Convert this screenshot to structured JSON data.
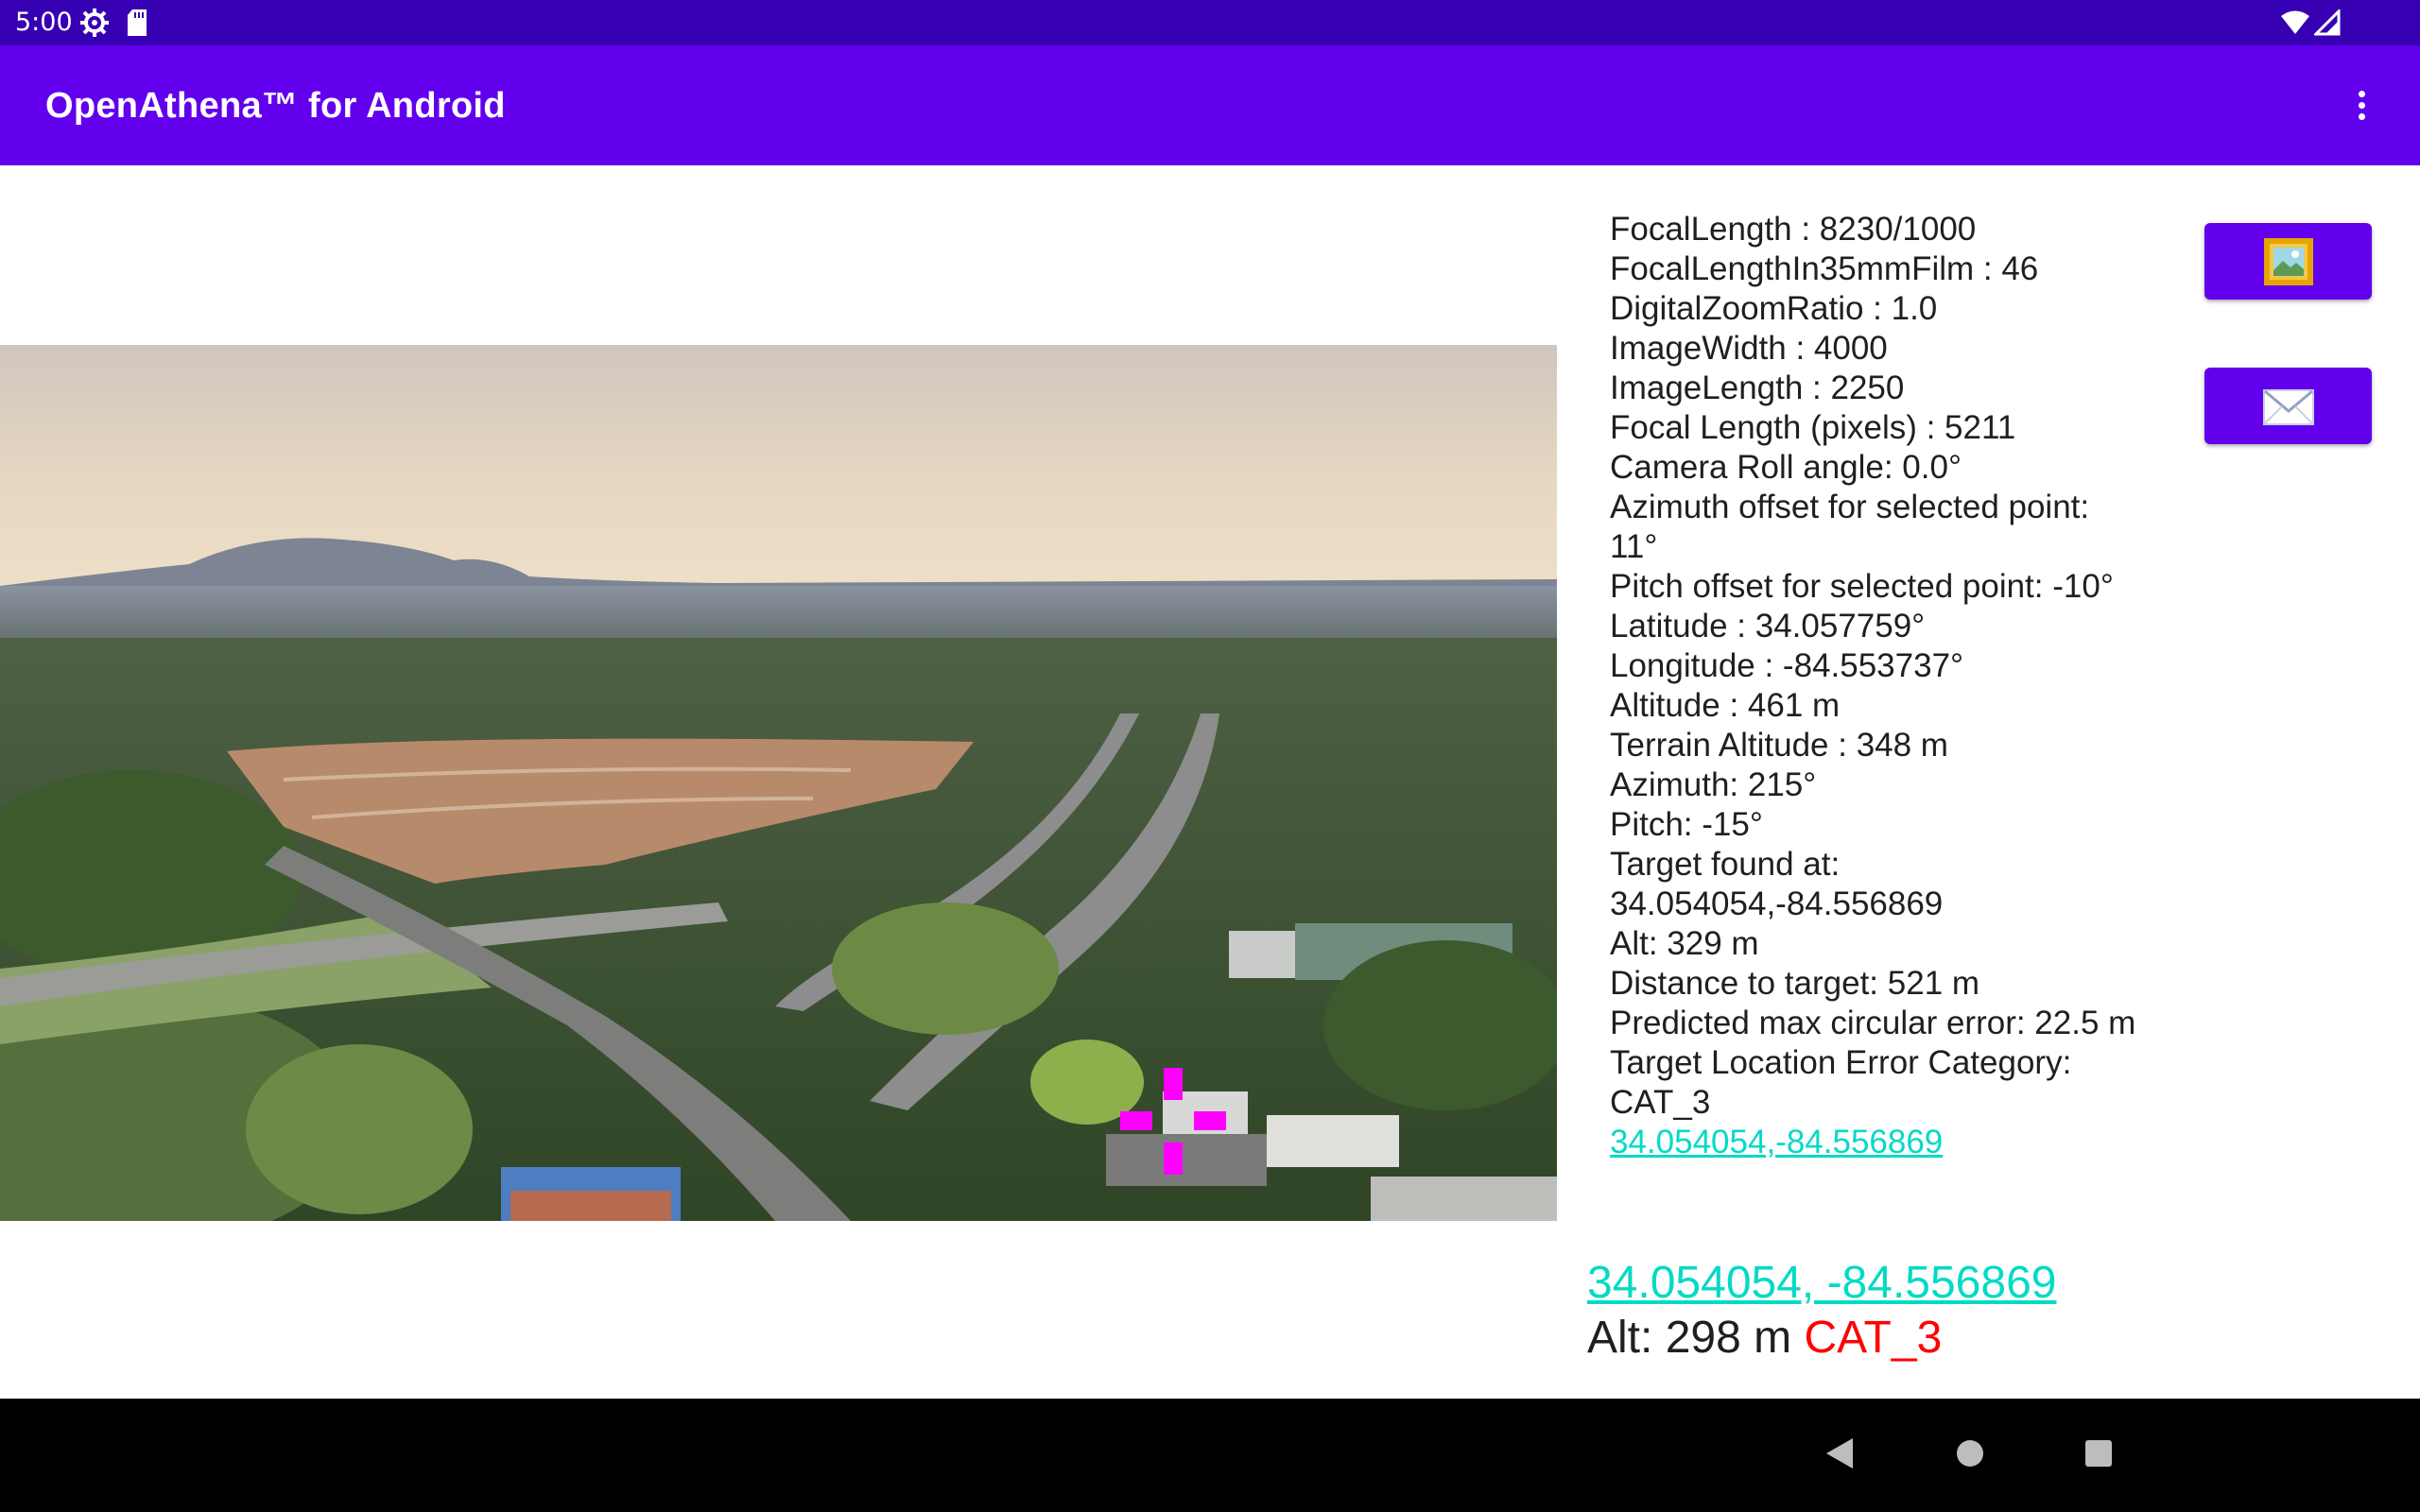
{
  "status_bar": {
    "time": "5:00",
    "icons": [
      "gear-icon",
      "sd-card-icon",
      "wifi-icon",
      "signal-icon"
    ]
  },
  "app_bar": {
    "title": "OpenAthena™ for Android",
    "menu_icon": "more-vert-icon"
  },
  "photo": {
    "description_icon": "aerial-photo",
    "marker_color": "#ff00ff"
  },
  "info": {
    "lines": [
      "FocalLength : 8230/1000",
      "FocalLengthIn35mmFilm : 46",
      "DigitalZoomRatio : 1.0",
      "ImageWidth : 4000",
      "ImageLength : 2250",
      "Focal Length (pixels) : 5211",
      "Camera Roll angle: 0.0°",
      "Azimuth offset for selected point:",
      "11°",
      "Pitch offset for selected point: -10°",
      "Latitude : 34.057759°",
      "Longitude : -84.553737°",
      "Altitude : 461 m",
      "Terrain Altitude : 348 m",
      "Azimuth: 215°",
      "Pitch: -15°",
      "Target found at:",
      "34.054054,-84.556869",
      "Alt: 329 m",
      "Distance to target: 521 m",
      "Predicted max circular error: 22.5 m",
      "Target Location Error Category:",
      "CAT_3"
    ],
    "link": "34.054054,-84.556869"
  },
  "buttons": {
    "select_image_icon": "image-icon",
    "send_icon": "envelope-icon"
  },
  "result": {
    "coords": "34.054054, -84.556869",
    "alt": "Alt: 298 m",
    "category": "CAT_3"
  },
  "colors": {
    "status_bar": "#3700b3",
    "app_bar": "#6200ee",
    "link": "#03dac5",
    "category": "#ff0000"
  },
  "nav_bar": {
    "icons": [
      "back-icon",
      "home-icon",
      "recents-icon"
    ]
  }
}
